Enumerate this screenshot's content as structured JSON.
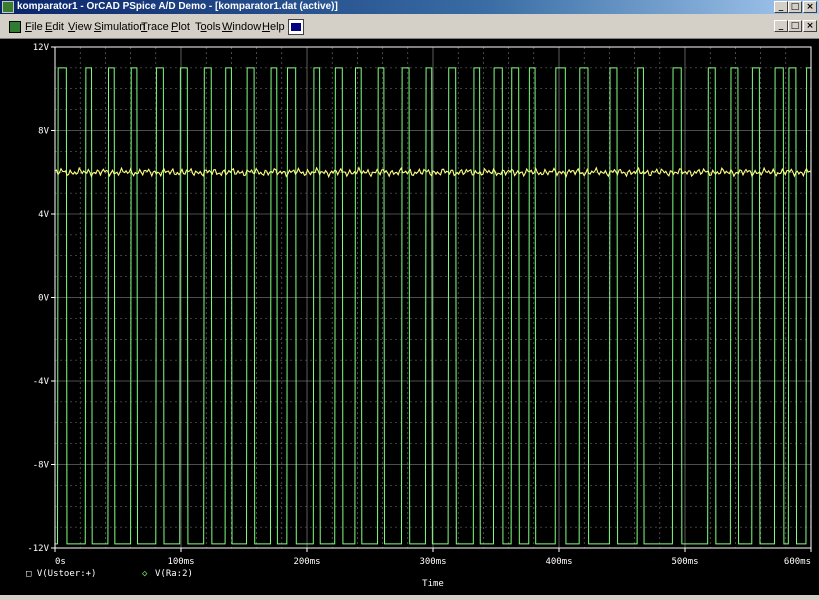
{
  "window": {
    "title": "komparator1 - OrCAD PSpice A/D Demo  - [komparator1.dat (active)]",
    "buttons": {
      "minimize": "_",
      "maximize": "□",
      "close": "×"
    }
  },
  "menu": {
    "items": [
      {
        "label": "File",
        "ul": "F",
        "rest": "ile"
      },
      {
        "label": "Edit",
        "ul": "E",
        "rest": "dit"
      },
      {
        "label": "View",
        "ul": "V",
        "rest": "iew"
      },
      {
        "label": "Simulation",
        "ul": "S",
        "rest": "imulation"
      },
      {
        "label": "Trace",
        "ul": "T",
        "rest": "race"
      },
      {
        "label": "Plot",
        "ul": "P",
        "rest": "lot"
      },
      {
        "label": "Tools",
        "ul": "o",
        "pre": "T",
        "rest": "ols"
      },
      {
        "label": "Window",
        "ul": "W",
        "rest": "indow"
      },
      {
        "label": "Help",
        "ul": "H",
        "rest": "elp"
      }
    ]
  },
  "chart_data": {
    "type": "line",
    "xlabel": "Time",
    "x_ticks": [
      "0s",
      "100ms",
      "200ms",
      "300ms",
      "400ms",
      "500ms",
      "600ms"
    ],
    "y_ticks": [
      "12V",
      "8V",
      "4V",
      "0V",
      "-4V",
      "-8V",
      "-12V"
    ],
    "xlim": [
      0,
      600
    ],
    "ylim": [
      -12,
      12
    ],
    "grid": true,
    "legend_position": "bottom-left",
    "series": [
      {
        "name": "V(Ustoer:+)",
        "marker": "□",
        "color": "#ffff80",
        "description": "noisy DC level",
        "mean": 6.0,
        "ripple": 0.2
      },
      {
        "name": "V(Ra:2)",
        "marker": "◇",
        "color": "#80ff80",
        "description": "square wave",
        "high": 11.0,
        "low": -11.8,
        "pulse_rising_edges_ms": [
          2,
          24,
          42,
          60,
          80,
          99,
          118,
          135,
          152,
          171,
          184,
          205,
          222,
          238,
          256,
          275,
          294,
          312,
          332,
          348,
          362,
          376,
          397,
          416,
          440,
          462,
          490,
          518,
          536,
          553,
          571,
          582,
          596
        ],
        "pulse_widths_ms": [
          7,
          5,
          5,
          5,
          6,
          6,
          6,
          5,
          6,
          5,
          7,
          5,
          6,
          5,
          5,
          6,
          5,
          6,
          5,
          7,
          6,
          5,
          8,
          7,
          6,
          5,
          7,
          6,
          6,
          6,
          7,
          6,
          5
        ]
      }
    ]
  }
}
